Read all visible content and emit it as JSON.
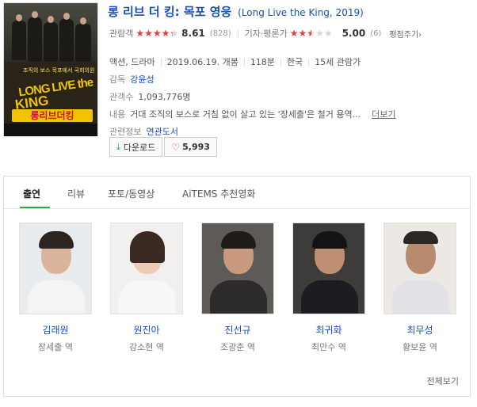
{
  "poster": {
    "tagline": "조직의 보스 목포에서 국회의원",
    "logo_en_1": "LONG LIVE the",
    "logo_en_2": "KING",
    "logo_ko": "롱리브더킹"
  },
  "movie": {
    "title": "롱 리브 더 킹: 목포 영웅",
    "original": "(Long Live the King, 2019)"
  },
  "ratings": {
    "audience_label": "관람객",
    "audience_score": "8.61",
    "audience_count": "(828)",
    "audience_fill_pct": 86.1,
    "critic_label": "기자·평론가",
    "critic_score": "5.00",
    "critic_count": "(6)",
    "critic_fill_pct": 50,
    "more": "평점주기",
    "more_arrow": "›"
  },
  "info": {
    "genre": "액션, 드라마",
    "release": "2019.06.19. 개봉",
    "runtime": "118분",
    "country": "한국",
    "grade": "15세 관람가",
    "director_label": "감독",
    "director": "강윤성",
    "audience_label": "관객수",
    "audience": "1,093,776명",
    "desc_label": "내용",
    "desc": "거대 조직의 보스로 거침 없이 살고 있는 '장세출'은 철거 용역...",
    "desc_more": "더보기",
    "related_label": "관련정보",
    "related": "연관도서"
  },
  "buttons": {
    "download": "다운로드",
    "like_count": "5,993"
  },
  "tabs": [
    "출연",
    "리뷰",
    "포토/동영상",
    "AiTEMS 추천영화"
  ],
  "cast": [
    {
      "name": "김래원",
      "role": "장세출 역"
    },
    {
      "name": "원진아",
      "role": "강소현 역"
    },
    {
      "name": "진선규",
      "role": "조광춘 역"
    },
    {
      "name": "최귀화",
      "role": "최만수 역"
    },
    {
      "name": "최무성",
      "role": "황보윤 역"
    }
  ],
  "view_all": "전체보기",
  "colors": {
    "link": "#1a4fb5",
    "star": "#ef3d3d",
    "accent": "#2aa64a"
  }
}
